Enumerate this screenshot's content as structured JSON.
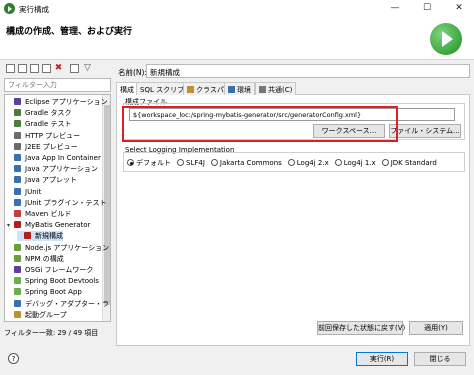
{
  "window": {
    "title": "実行構成",
    "minimize": "—",
    "maximize": "☐",
    "close": "✕"
  },
  "header": {
    "title": "構成の作成、管理、および実行"
  },
  "left": {
    "filter_placeholder": "フィルター入力",
    "tree": [
      {
        "label": "Eclipse アプリケーション",
        "color": "#5b3fa0",
        "indent": 0,
        "expander": ""
      },
      {
        "label": "Gradle タスク",
        "color": "#4a7c3a",
        "indent": 0,
        "expander": ""
      },
      {
        "label": "Gradle テスト",
        "color": "#4a7c3a",
        "indent": 0,
        "expander": ""
      },
      {
        "label": "HTTP プレビュー",
        "color": "#6a6a6a",
        "indent": 0,
        "expander": ""
      },
      {
        "label": "J2EE プレビュー",
        "color": "#6a6a6a",
        "indent": 0,
        "expander": ""
      },
      {
        "label": "Java App In Container",
        "color": "#3a6fb0",
        "indent": 0,
        "expander": ""
      },
      {
        "label": "Java アプリケーション",
        "color": "#3a6fb0",
        "indent": 0,
        "expander": ""
      },
      {
        "label": "Java アプレット",
        "color": "#3a6fb0",
        "indent": 0,
        "expander": ""
      },
      {
        "label": "JUnit",
        "color": "#3a6fb0",
        "indent": 0,
        "expander": ""
      },
      {
        "label": "JUnit プラグイン・テスト",
        "color": "#3a6fb0",
        "indent": 0,
        "expander": ""
      },
      {
        "label": "Maven ビルド",
        "color": "#c04040",
        "indent": 0,
        "expander": ""
      },
      {
        "label": "MyBatis Generator",
        "color": "#b02020",
        "indent": 0,
        "expander": "▾"
      },
      {
        "label": "新規構成",
        "color": "#b02020",
        "indent": 1,
        "expander": "",
        "selected": true
      },
      {
        "label": "Node.js アプリケーション",
        "color": "#6a9f3a",
        "indent": 0,
        "expander": ""
      },
      {
        "label": "NPM の構成",
        "color": "#6a9f3a",
        "indent": 0,
        "expander": ""
      },
      {
        "label": "OSGi フレームワーク",
        "color": "#5b3fa0",
        "indent": 0,
        "expander": ""
      },
      {
        "label": "Spring Boot Devtools",
        "color": "#6ab04a",
        "indent": 0,
        "expander": ""
      },
      {
        "label": "Spring Boot App",
        "color": "#6ab04a",
        "indent": 0,
        "expander": ""
      },
      {
        "label": "デバッグ・アダプター・ランチャ",
        "color": "#3a6fb0",
        "indent": 0,
        "expander": ""
      },
      {
        "label": "起動グループ",
        "color": "#c09030",
        "indent": 0,
        "expander": ""
      }
    ],
    "filter_status": "フィルター一致: 29 / 49 項目"
  },
  "right": {
    "name_label": "名前(N):",
    "name_value": "新規構成",
    "tabs": [
      {
        "label": "構成",
        "active": true,
        "color": ""
      },
      {
        "label": "SQL スクリプト",
        "active": false,
        "color": ""
      },
      {
        "label": "クラスパス",
        "active": false,
        "color": "#c09030"
      },
      {
        "label": "環境",
        "active": false,
        "color": "#3a6fb0"
      },
      {
        "label": "共通(C)",
        "active": false,
        "color": "#777777"
      }
    ],
    "config_file_group": "構成ファイル",
    "config_file_value": "${workspace_loc:/spring-mybatis-generator/src/generatorConfig.xml}",
    "workspace_button": "ワークスペース...",
    "filesystem_button": "ファイル・システム...",
    "logging_group": "Select Logging Implementation",
    "logging_options": [
      {
        "label": "デフォルト",
        "checked": true
      },
      {
        "label": "SLF4J",
        "checked": false
      },
      {
        "label": "Jakarta Commons",
        "checked": false
      },
      {
        "label": "Log4j 2.x",
        "checked": false
      },
      {
        "label": "Log4j 1.x",
        "checked": false
      },
      {
        "label": "JDK Standard",
        "checked": false
      }
    ],
    "revert_button": "前回保存した状態に戻す(V)",
    "apply_button": "適用(Y)"
  },
  "footer": {
    "help": "?",
    "run_button": "実行(R)",
    "close_button": "閉じる"
  }
}
